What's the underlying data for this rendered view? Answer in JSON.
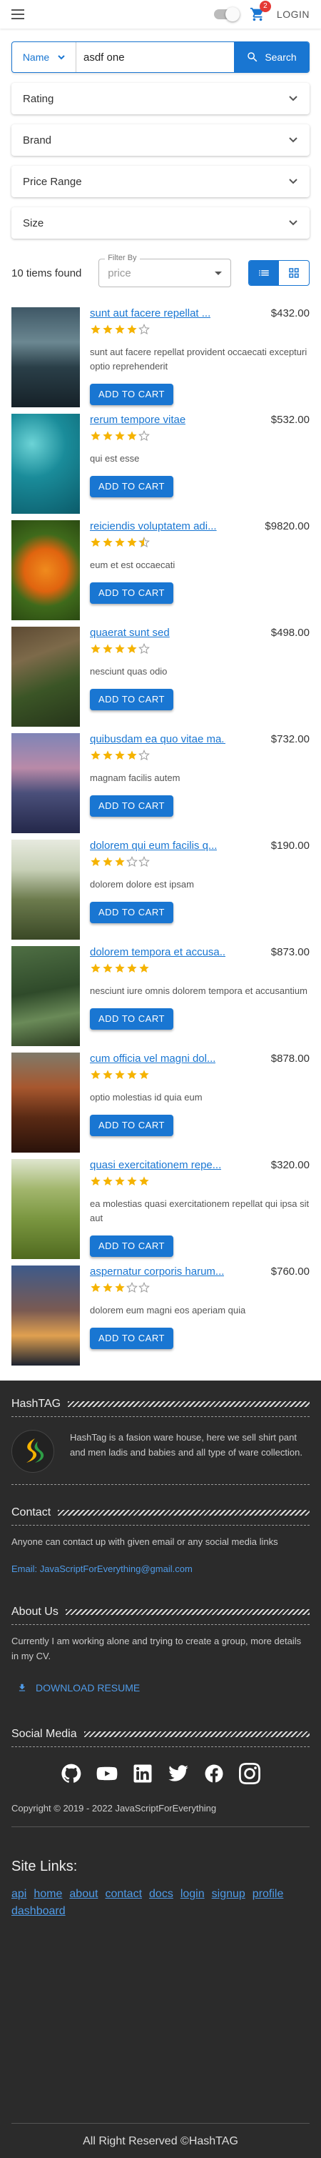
{
  "header": {
    "cart_count": "2",
    "login_label": "LOGIN"
  },
  "search": {
    "field": "Name",
    "query": "asdf one",
    "button": "Search"
  },
  "filters": [
    "Rating",
    "Brand",
    "Price Range",
    "Size"
  ],
  "results": {
    "count_label": "10 tiems found",
    "sort_label": "Filter By",
    "sort_placeholder": "price"
  },
  "products": [
    {
      "name": "sunt aut facere repellat ...",
      "price": "$432.00",
      "rating": 4,
      "desc": "sunt aut facere repellat provident occaecati excepturi optio reprehenderit",
      "button": "ADD TO CART"
    },
    {
      "name": "rerum tempore vitae",
      "price": "$532.00",
      "rating": 4,
      "desc": "qui est esse",
      "button": "ADD TO CART"
    },
    {
      "name": "reiciendis voluptatem adi...",
      "price": "$9820.00",
      "rating": 4.5,
      "desc": "eum et est occaecati",
      "button": "ADD TO CART"
    },
    {
      "name": "quaerat sunt sed",
      "price": "$498.00",
      "rating": 4,
      "desc": "nesciunt quas odio",
      "button": "ADD TO CART"
    },
    {
      "name": "quibusdam ea quo vitae ma...",
      "price": "$732.00",
      "rating": 4,
      "desc": "magnam facilis autem",
      "button": "ADD TO CART"
    },
    {
      "name": "dolorem qui eum facilis q...",
      "price": "$190.00",
      "rating": 3,
      "desc": "dolorem dolore est ipsam",
      "button": "ADD TO CART"
    },
    {
      "name": "dolorem tempora et accusa...",
      "price": "$873.00",
      "rating": 5,
      "desc": "nesciunt iure omnis dolorem tempora et accusantium",
      "button": "ADD TO CART"
    },
    {
      "name": "cum officia vel magni dol...",
      "price": "$878.00",
      "rating": 5,
      "desc": "optio molestias id quia eum",
      "button": "ADD TO CART"
    },
    {
      "name": "quasi exercitationem repe...",
      "price": "$320.00",
      "rating": 5,
      "desc": "ea molestias quasi exercitationem repellat qui ipsa sit aut",
      "button": "ADD TO CART"
    },
    {
      "name": "aspernatur corporis harum...",
      "price": "$760.00",
      "rating": 3,
      "desc": "dolorem eum magni eos aperiam quia",
      "button": "ADD TO CART"
    }
  ],
  "footer": {
    "brand_title": "HashTAG",
    "brand_text": "HashTag is a fasion ware house, here we sell shirt pant and men ladis and babies and all type of ware collection.",
    "contact_title": "Contact",
    "contact_text": "Anyone can contact up with given email or any social media links",
    "email": "Email: JavaScriptForEverything@gmail.com",
    "about_title": "About Us",
    "about_text": "Currently I am working alone and trying to create a group, more details in my CV.",
    "resume_label": "DOWNLOAD RESUME",
    "social_title": "Social Media",
    "copyright": "Copyright © 2019 - 2022 JavaScriptForEverything",
    "site_links_title": "Site Links:",
    "links": [
      "api",
      "home",
      "about",
      "contact",
      "docs",
      "login",
      "signup",
      "profile",
      "dashboard"
    ],
    "rights": "All Right Reserved ©HashTAG"
  },
  "colors": {
    "primary": "#1976d2",
    "star": "#f5b301",
    "footer_bg": "#2b2b2b",
    "link": "#4f9be8"
  }
}
